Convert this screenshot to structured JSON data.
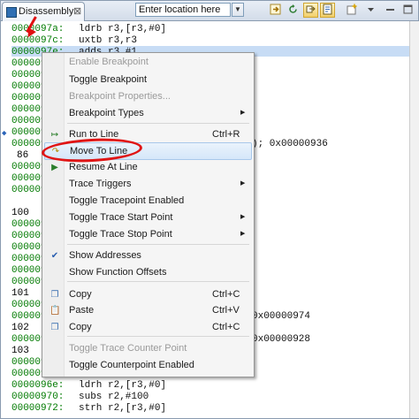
{
  "tab": {
    "title": "Disassembly",
    "close": "⊠"
  },
  "location": {
    "value": "Enter location here",
    "dropdown": "▼"
  },
  "toolbar_icons": [
    "go-to-pc-icon",
    "refresh-icon",
    "link-editor-icon",
    "show-source-icon",
    "new-view-icon",
    "view-menu-icon",
    "minimize-icon"
  ],
  "code_rows": [
    {
      "addr": "0000097a:",
      "instr": "ldrb r3,[r3,#0]"
    },
    {
      "addr": "0000097c:",
      "instr": "uxtb r3,r3"
    },
    {
      "addr": "0000097e:",
      "instr": "adds r3,#1"
    },
    {
      "addr": "00000980:",
      "instr": ""
    },
    {
      "addr": "00000982:",
      "instr": ""
    },
    {
      "addr": "00000984:",
      "instr": ""
    },
    {
      "addr": "00000986:",
      "instr": ""
    },
    {
      "addr": "00000988:",
      "instr": ""
    },
    {
      "addr": "0000098a:",
      "instr": ""
    },
    {
      "addr": "0000098c:",
      "instr": ""
    },
    {
      "addr": "0000098e:",
      "instr": "); 0x00000936"
    },
    {
      "lnum": "86",
      "instr": ""
    },
    {
      "addr": "00000990:",
      "instr": ""
    },
    {
      "addr": "00000992:",
      "instr": ""
    },
    {
      "addr": "00000994:",
      "instr": ""
    },
    {
      "addr": "",
      "instr": ""
    },
    {
      "lnum": "100",
      "instr": ""
    },
    {
      "addr": "00000996:",
      "instr": ""
    },
    {
      "addr": "00000998:",
      "instr": ""
    },
    {
      "addr": "0000099a:",
      "instr": ""
    },
    {
      "addr": "0000099c:",
      "instr": ""
    },
    {
      "addr": "0000099e:",
      "instr": ""
    },
    {
      "addr": "000009a0:",
      "instr": ""
    },
    {
      "lnum": "101",
      "instr": ""
    },
    {
      "addr": "000009a2:",
      "instr": ""
    },
    {
      "addr": "000009a4:",
      "instr": "0x00000974"
    },
    {
      "lnum": "102",
      "instr": ""
    },
    {
      "addr": "000009a6:",
      "instr": "0x00000928"
    },
    {
      "lnum": "103",
      "instr": ""
    },
    {
      "addr": "000009a8:",
      "instr": ""
    },
    {
      "addr": "000009aa:",
      "instr": ""
    },
    {
      "addr": "0000096e:",
      "instr": "ldrh r2,[r3,#0]"
    },
    {
      "addr": "00000970:",
      "instr": "subs r2,#100"
    },
    {
      "addr": "00000972:",
      "instr": "strh r2,[r3,#0]"
    }
  ],
  "menu": {
    "items": [
      {
        "label": "Enable Breakpoint",
        "disabled": true
      },
      {
        "label": "Toggle Breakpoint"
      },
      {
        "label": "Breakpoint Properties...",
        "disabled": true
      },
      {
        "label": "Breakpoint Types",
        "submenu": "▶"
      },
      {
        "label": "Run to Line",
        "shortcut": "Ctrl+R"
      },
      {
        "label": "Move To Line"
      },
      {
        "label": "Resume At Line"
      },
      {
        "label": "Trace Triggers",
        "submenu": "▶"
      },
      {
        "label": "Toggle Tracepoint Enabled"
      },
      {
        "label": "Toggle Trace Start Point",
        "submenu": "▶"
      },
      {
        "label": "Toggle Trace Stop Point",
        "submenu": "▶"
      },
      {
        "label": "Show Addresses",
        "check": "✔"
      },
      {
        "label": "Show Function Offsets"
      },
      {
        "label": "Copy",
        "shortcut": "Ctrl+C"
      },
      {
        "label": "Paste",
        "shortcut": "Ctrl+V"
      },
      {
        "label": "Copy",
        "shortcut": "Ctrl+C"
      },
      {
        "label": "Toggle Trace Counter Point",
        "disabled": true
      },
      {
        "label": "Toggle Counterpoint Enabled"
      }
    ]
  },
  "colors": {
    "address": "#007a00",
    "highlight": "#c7dcf5",
    "annotation": "#e01515"
  }
}
